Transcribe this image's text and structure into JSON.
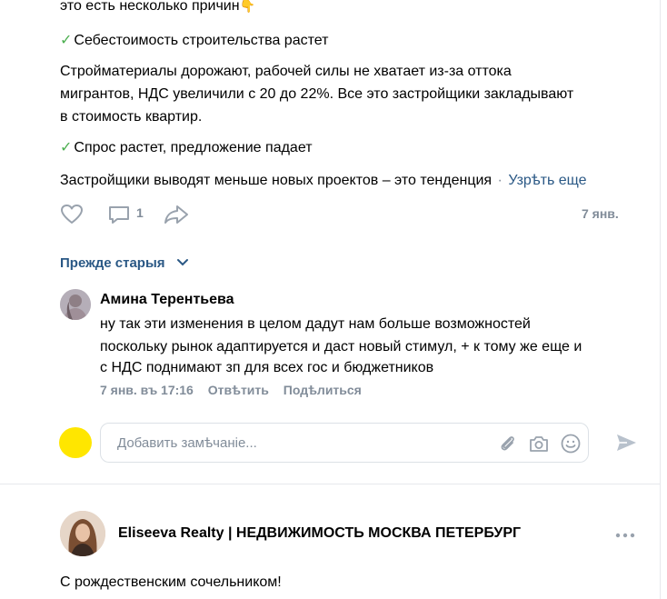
{
  "post": {
    "line0_text": "это есть несколько причин",
    "line0_emoji": "👇",
    "point1": "Себестоимость строительства растет",
    "para1_l1": "Стройматериалы дорожают, рабочей силы не хватает из-за оттока",
    "para1_l2": "мигрантов, НДС увеличили с 20 до 22%. Все это застройщики закладывают",
    "para1_l3": "в стоимость квартир.",
    "point2": "Спрос растет, предложение падает",
    "para2_l1": "Застройщики выводят меньше новых проектов – это тенденция",
    "show_more": "Узрѣть еще",
    "comments_count": "1",
    "date": "7 янв."
  },
  "comments": {
    "toggle_label": "Прежде старыя",
    "items": [
      {
        "author": "Амина Терентьева",
        "l1": "ну так эти изменения в целом дадут нам больше возможностей",
        "l2": "поскольку рынок адаптируется и даст новый стимул, + к тому же еще и",
        "l3": "с НДС поднимают зп для всех гос и бюджетников",
        "time": "7 янв. въ 17:16",
        "reply": "Отвѣтить",
        "share": "Подѣлиться"
      }
    ],
    "input_placeholder": "Добавить замѣчаніе..."
  },
  "next_post": {
    "author": "Eliseeva Realty | НЕДВИЖИМОСТЬ МОСКВА ПЕТЕРБУРГ",
    "text": "С рождественским сочельником!"
  },
  "colors": {
    "link": "#2a5885",
    "muted": "#818c99",
    "check": "#4caf50",
    "avatar_self": "#ffe600"
  }
}
